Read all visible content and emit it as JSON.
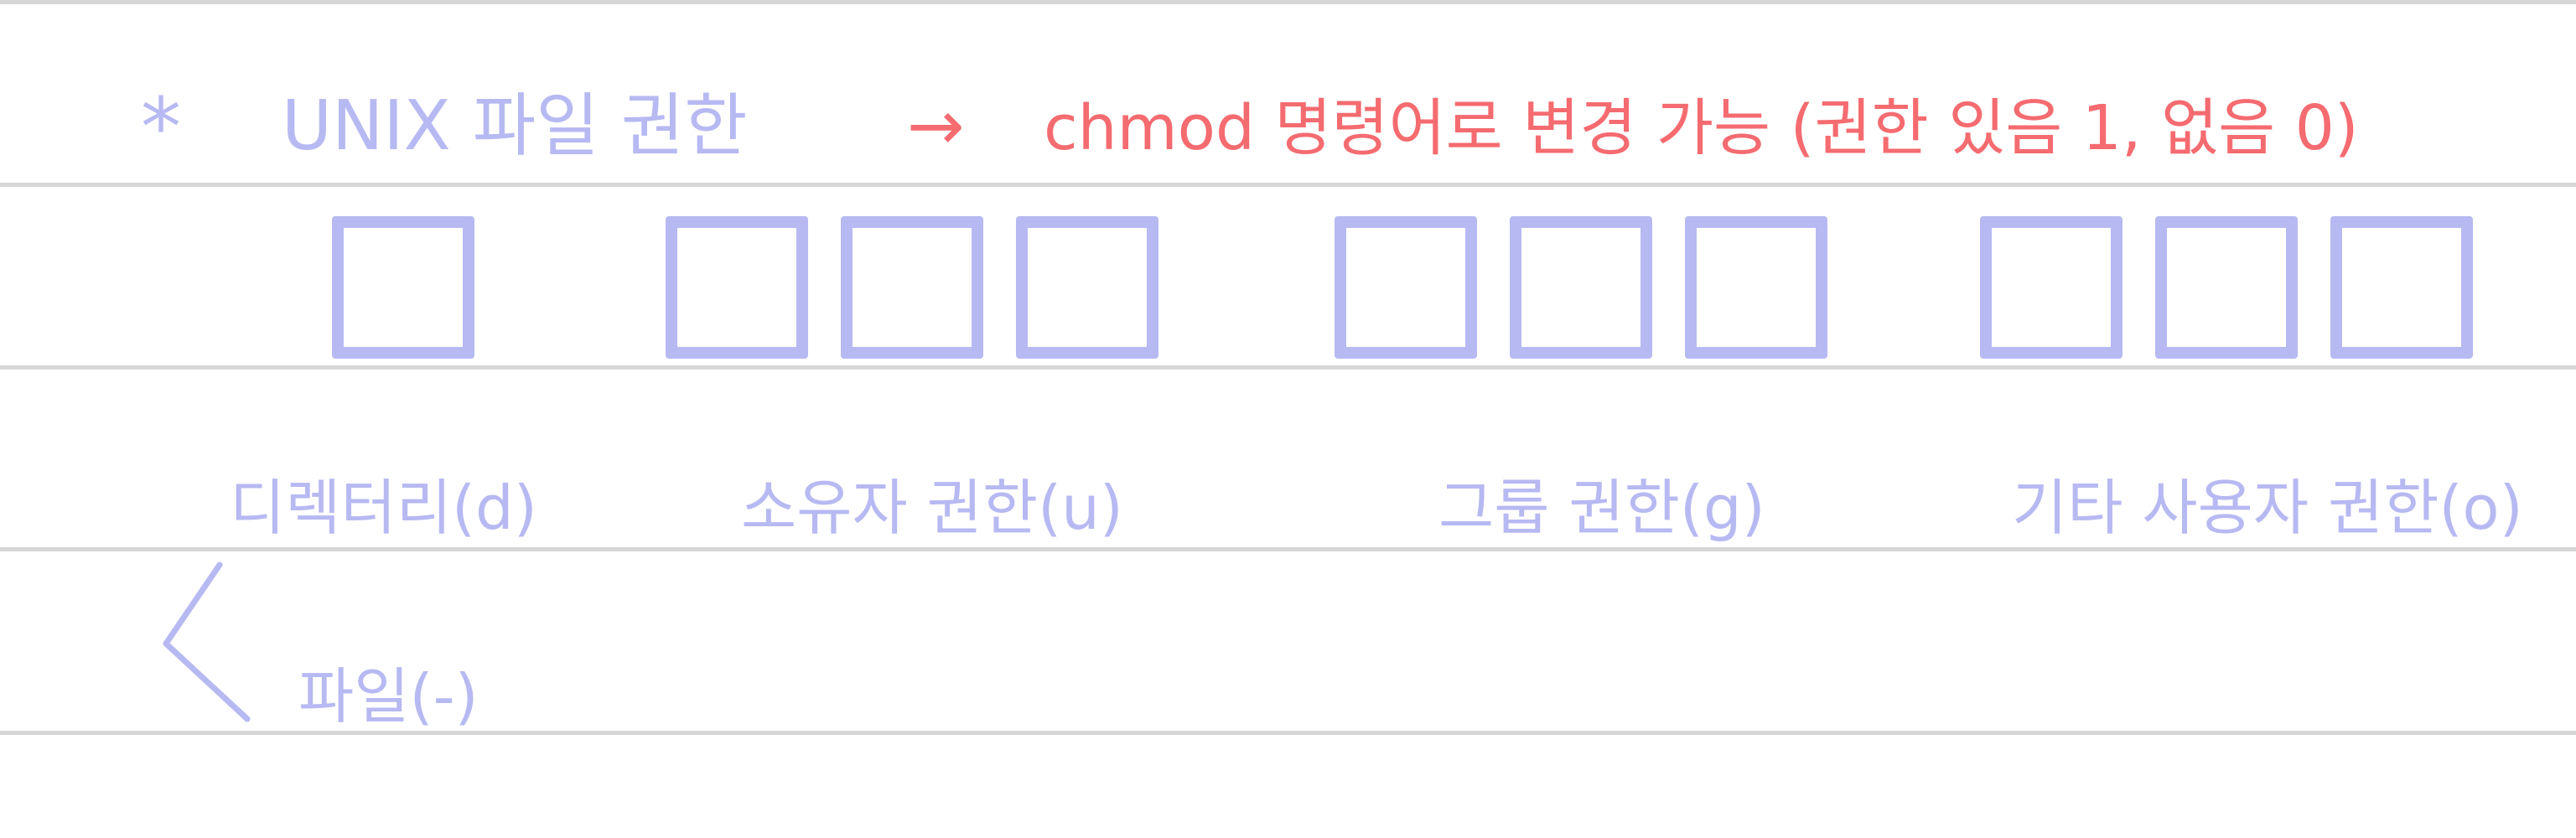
{
  "note": {
    "bullet": "*",
    "title": "UNIX 파일 권한",
    "arrow": "→",
    "description": "chmod 명령어로 변경 가능 (권한 있음 1, 없음 0)"
  },
  "permission_groups": [
    {
      "label": "디렉터리(d)",
      "box_count": 1
    },
    {
      "label": "소유자 권한(u)",
      "box_count": 3
    },
    {
      "label": "그룹 권한(g)",
      "box_count": 3
    },
    {
      "label": "기타 사용자 권한(o)",
      "box_count": 3
    }
  ],
  "alternative": {
    "label": "파일(-)"
  },
  "colors": {
    "ink_blue": "#b7b9f2",
    "ink_red": "#f46b70",
    "rule_line": "#d6d6d6",
    "paper": "#ffffff"
  }
}
